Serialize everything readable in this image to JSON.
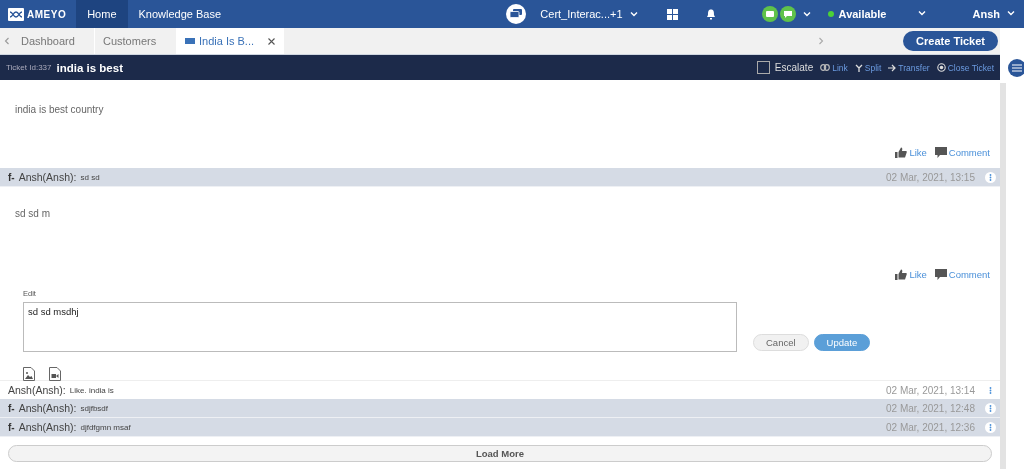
{
  "nav": {
    "logo": "AMEYO",
    "items": [
      {
        "label": "Home",
        "selected": true
      },
      {
        "label": "Knowledge Base",
        "selected": false
      }
    ],
    "campaign": "Cert_Interac...+1",
    "status": {
      "label": "Available",
      "color": "#4cd137"
    },
    "user": "Ansh"
  },
  "tabs": [
    {
      "label": "Dashboard",
      "selected": false,
      "closable": false
    },
    {
      "label": "Customers",
      "selected": false,
      "closable": false
    },
    {
      "label": "India Is B...",
      "selected": true,
      "closable": true
    }
  ],
  "create_button": "Create Ticket",
  "ticket": {
    "id_label": "Ticket Id:337",
    "title": "india is best",
    "escalate": {
      "label": "Escalate",
      "checked": false
    },
    "actions": [
      {
        "kind": "link",
        "label": "Link"
      },
      {
        "kind": "split",
        "label": "Split"
      },
      {
        "kind": "transfer",
        "label": "Transfer"
      },
      {
        "kind": "close",
        "label": "Close Ticket"
      }
    ]
  },
  "post": {
    "body": "india is best country",
    "actions": [
      "Like",
      "Comment"
    ]
  },
  "comments": [
    {
      "kind": "facebook",
      "prefix": "f-",
      "author": "Ansh(Ansh):",
      "text": "sd sd",
      "time": "02 Mar, 2021, 13:15",
      "expanded": true,
      "body": "sd sd m",
      "actions": [
        "Like",
        "Comment"
      ],
      "editor": {
        "label": "Edit",
        "value": "sd sd msdhj",
        "buttons": [
          "Cancel",
          "Update"
        ]
      }
    },
    {
      "kind": "plain",
      "author": "Ansh(Ansh):",
      "text": "Like. india is",
      "time": "02 Mar, 2021, 13:14",
      "expanded": false
    },
    {
      "kind": "facebook",
      "prefix": "f-",
      "author": "Ansh(Ansh):",
      "text": "sdjfbsdf",
      "time": "02 Mar, 2021, 12:48",
      "expanded": false
    },
    {
      "kind": "facebook",
      "prefix": "f-",
      "author": "Ansh(Ansh):",
      "text": "djfdfgmn msaf",
      "time": "02 Mar, 2021, 12:36",
      "expanded": false
    }
  ],
  "load_more": "Load More"
}
